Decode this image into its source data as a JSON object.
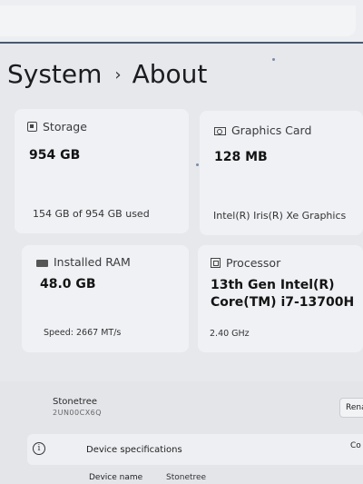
{
  "breadcrumb": {
    "parent": "System",
    "separator": "›",
    "current": "About"
  },
  "cards": {
    "storage": {
      "icon": "storage-icon",
      "title": "Storage",
      "value": "954 GB",
      "detail": "154 GB of 954 GB used"
    },
    "graphics": {
      "icon": "graphics-card-icon",
      "title": "Graphics Card",
      "value": "128 MB",
      "detail": "Intel(R) Iris(R) Xe Graphics"
    },
    "ram": {
      "icon": "ram-icon",
      "title": "Installed RAM",
      "value": "48.0 GB",
      "detail": "Speed: 2667 MT/s"
    },
    "processor": {
      "icon": "processor-icon",
      "title": "Processor",
      "value_line1": "13th Gen Intel(R)",
      "value_line2": "Core(TM) i7-13700H",
      "detail": "2.40 GHz"
    }
  },
  "device": {
    "name": "Stonetree",
    "id": "2UN00CX6Q",
    "rename_label": "Rena"
  },
  "specs": {
    "icon": "info-icon",
    "title": "Device specifications",
    "copy_label": "Co",
    "rows": [
      {
        "label": "Device name",
        "value": "Stonetree"
      }
    ]
  }
}
